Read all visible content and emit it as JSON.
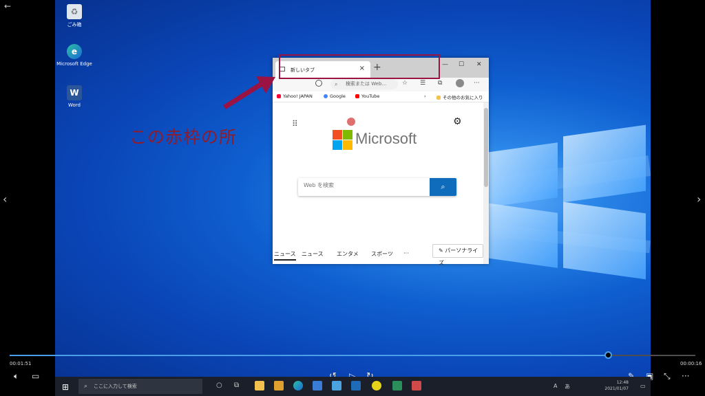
{
  "desktop": {
    "icons": [
      {
        "label": "ごみ箱",
        "icon": "recycle-bin-icon"
      },
      {
        "label": "Microsoft Edge",
        "icon": "edge-icon"
      },
      {
        "label": "Word",
        "icon": "word-icon"
      }
    ]
  },
  "browser": {
    "tab_label": "新しいタブ",
    "tab_close": "×",
    "new_tab": "+",
    "window_controls": {
      "minimize": "—",
      "maximize": "☐",
      "close": "✕"
    },
    "address_placeholder": "検索または Web...",
    "favorites": [
      {
        "label": "Yahoo! JAPAN",
        "color": "#ff0033"
      },
      {
        "label": "Google",
        "color": "#4285f4"
      },
      {
        "label": "YouTube",
        "color": "#ff0000"
      }
    ],
    "other_favorites": "その他のお気に入り",
    "brand": "Microsoft",
    "search_placeholder": "Web を検索",
    "news_tabs": [
      "ニュース",
      "ニュース",
      "エンタメ",
      "スポーツ",
      "···"
    ],
    "personalize": "パーソナライズ"
  },
  "annotation": {
    "note": "この赤枠の所",
    "color": "#9a1343"
  },
  "player": {
    "elapsed": "00:01:51",
    "remaining": "00:00:16",
    "progress": 0.872,
    "skip_back": "10",
    "skip_forward": "30"
  },
  "taskbar": {
    "search_placeholder": "ここに入力して検索",
    "time": "12:48",
    "date": "2021/01/07",
    "ime": "A",
    "ime2": "あ"
  }
}
